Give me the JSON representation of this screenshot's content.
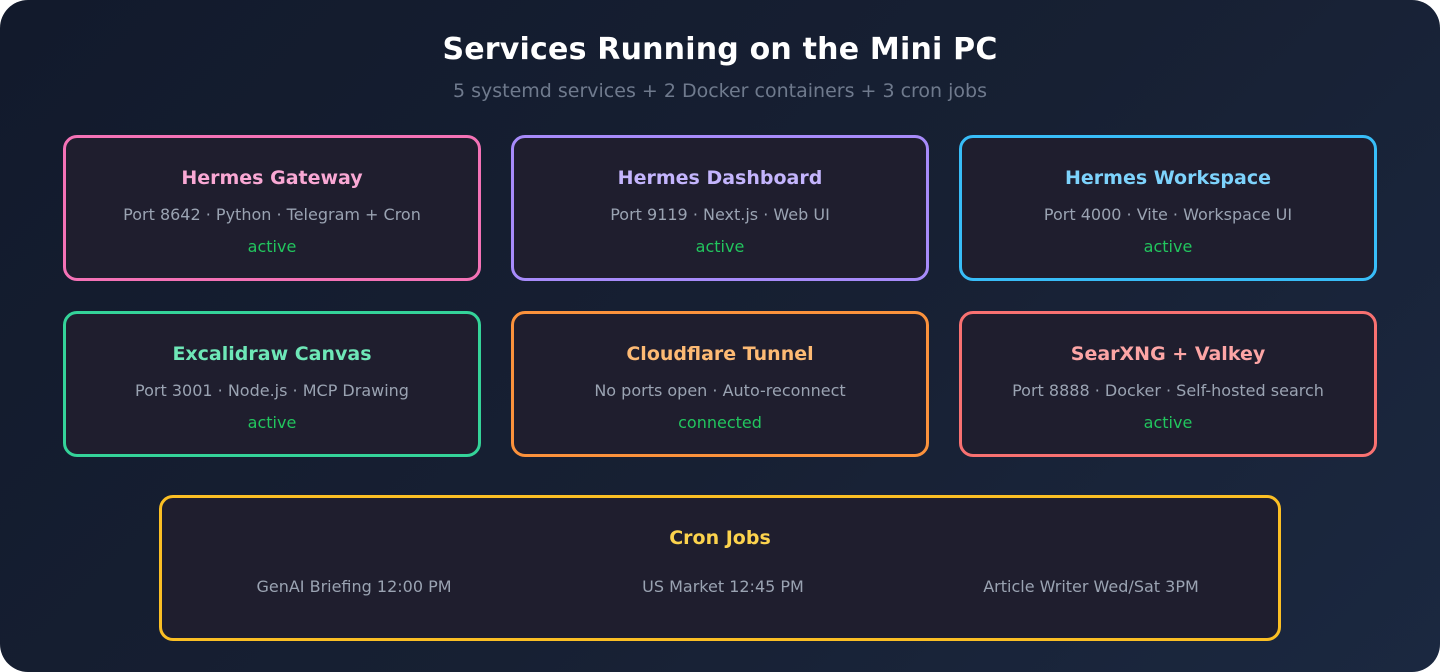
{
  "header": {
    "title": "Services Running on the Mini PC",
    "subtitle": "5 systemd services + 2 Docker containers + 3 cron jobs"
  },
  "services": [
    {
      "name": "Hermes Gateway",
      "details": "Port 8642 · Python · Telegram + Cron",
      "status": "active",
      "border_color": "#f472b6",
      "title_color": "#f9a8d4"
    },
    {
      "name": "Hermes Dashboard",
      "details": "Port 9119 · Next.js · Web UI",
      "status": "active",
      "border_color": "#a78bfa",
      "title_color": "#c4b5fd"
    },
    {
      "name": "Hermes Workspace",
      "details": "Port 4000 · Vite · Workspace UI",
      "status": "active",
      "border_color": "#38bdf8",
      "title_color": "#7dd3fc"
    },
    {
      "name": "Excalidraw Canvas",
      "details": "Port 3001 · Node.js · MCP Drawing",
      "status": "active",
      "border_color": "#34d399",
      "title_color": "#6ee7b7"
    },
    {
      "name": "Cloudflare Tunnel",
      "details": "No ports open · Auto-reconnect",
      "status": "connected",
      "border_color": "#fb923c",
      "title_color": "#fdba74"
    },
    {
      "name": "SearXNG + Valkey",
      "details": "Port 8888 · Docker · Self-hosted search",
      "status": "active",
      "border_color": "#f87171",
      "title_color": "#fca5a5"
    }
  ],
  "cron": {
    "title": "Cron Jobs",
    "jobs": [
      "GenAI Briefing 12:00 PM",
      "US Market 12:45 PM",
      "Article Writer Wed/Sat 3PM"
    ],
    "border_color": "#fbbf24",
    "title_color": "#fcd34d"
  },
  "colors": {
    "status_active": "#22c55e",
    "card_background": "#1f1e2e"
  }
}
